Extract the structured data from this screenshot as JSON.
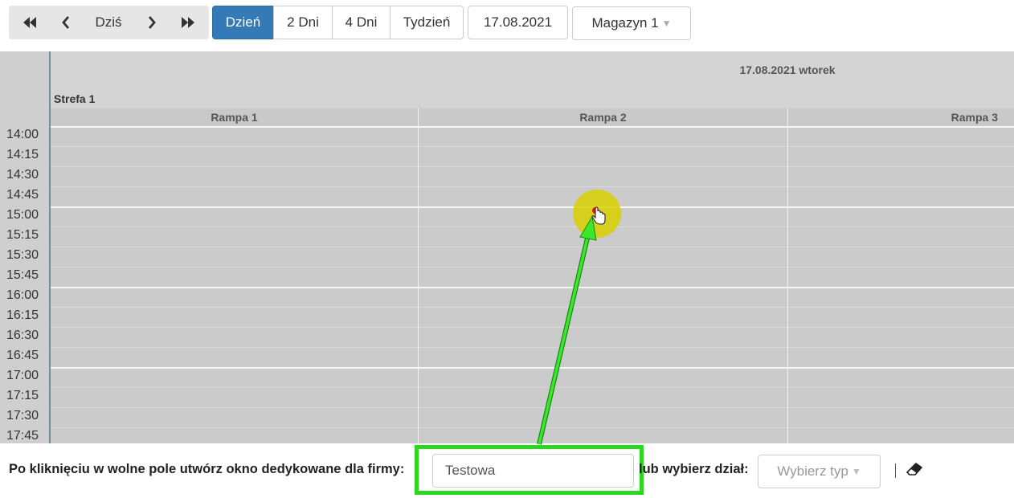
{
  "toolbar": {
    "nav": {
      "first_icon": "double-chevron-left-icon",
      "prev_icon": "chevron-left-icon",
      "today_label": "Dziś",
      "next_icon": "chevron-right-icon",
      "last_icon": "double-chevron-right-icon"
    },
    "views": [
      {
        "label": "Dzień",
        "active": true
      },
      {
        "label": "2 Dni",
        "active": false
      },
      {
        "label": "4 Dni",
        "active": false
      },
      {
        "label": "Tydzień",
        "active": false
      }
    ],
    "date": "17.08.2021",
    "warehouse": {
      "selected": "Magazyn 1",
      "caret": "▼"
    }
  },
  "calendar": {
    "day_title": "17.08.2021 wtorek",
    "zone": "Strefa 1",
    "ramps": [
      "Rampa 1",
      "Rampa 2",
      "Rampa 3"
    ],
    "times": [
      "14:00",
      "14:15",
      "14:30",
      "14:45",
      "15:00",
      "15:15",
      "15:30",
      "15:45",
      "16:00",
      "16:15",
      "16:30",
      "16:45",
      "17:00",
      "17:15",
      "17:30",
      "17:45"
    ]
  },
  "form": {
    "label_firm": "Po kliknięciu w wolne pole utwórz okno dedykowane dla firmy:",
    "firm_value": "Testowa",
    "label_dept": "lub wybierz dział:",
    "type_placeholder": "Wybierz typ",
    "type_caret": "▼",
    "clear_icon": "eraser-icon"
  },
  "colors": {
    "accent": "#337ab7",
    "highlight": "#d8d000",
    "annotation": "#2bd71f",
    "grid_bg": "#cbcbcb"
  }
}
